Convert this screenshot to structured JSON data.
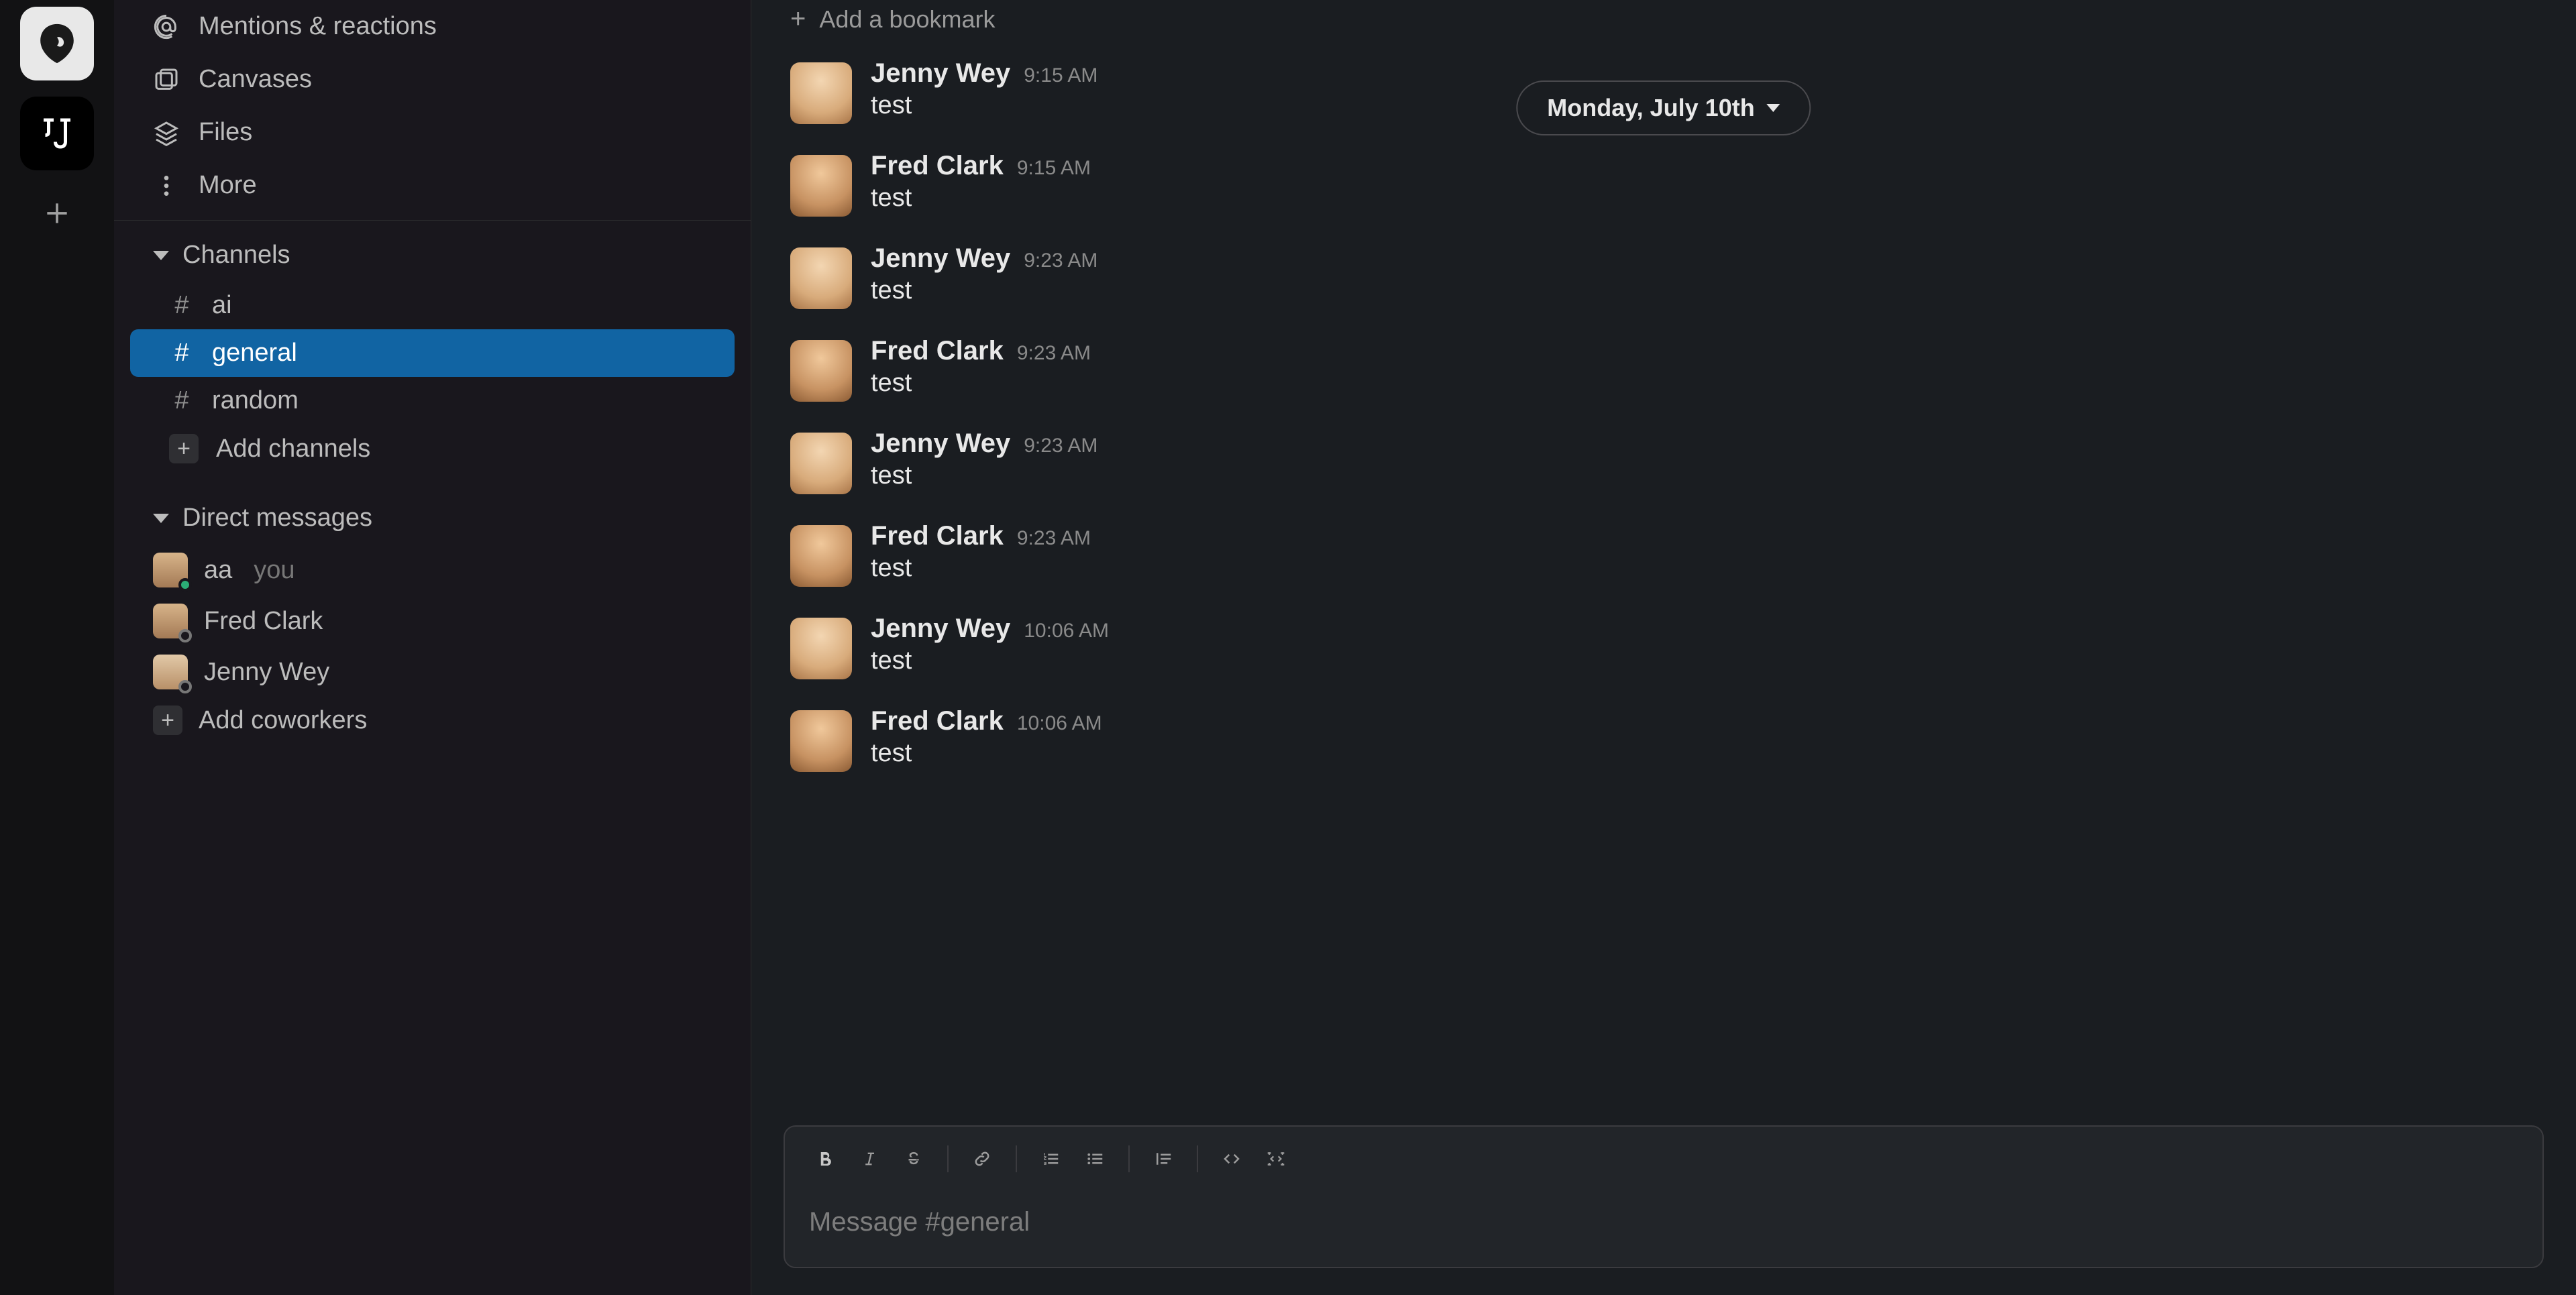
{
  "bookmark": {
    "label": "Add a bookmark"
  },
  "date_divider": "Monday, July 10th",
  "sidebar": {
    "browse": {
      "mentions": "Mentions & reactions",
      "canvases": "Canvases",
      "files": "Files",
      "more": "More"
    },
    "channels_header": "Channels",
    "channels": [
      {
        "name": "ai",
        "active": false
      },
      {
        "name": "general",
        "active": true
      },
      {
        "name": "random",
        "active": false
      }
    ],
    "add_channels": "Add channels",
    "dms_header": "Direct messages",
    "dms": [
      {
        "name": "aa",
        "you": "you",
        "avatar": "you",
        "presence": "online"
      },
      {
        "name": "Fred Clark",
        "avatar": "fred",
        "presence": "offline"
      },
      {
        "name": "Jenny Wey",
        "avatar": "jenny",
        "presence": "offline"
      }
    ],
    "add_coworkers": "Add coworkers"
  },
  "messages": [
    {
      "author": "Jenny Wey",
      "time": "9:15 AM",
      "text": "test",
      "avatar": "jenny"
    },
    {
      "author": "Fred Clark",
      "time": "9:15 AM",
      "text": "test",
      "avatar": "fred"
    },
    {
      "author": "Jenny Wey",
      "time": "9:23 AM",
      "text": "test",
      "avatar": "jenny"
    },
    {
      "author": "Fred Clark",
      "time": "9:23 AM",
      "text": "test",
      "avatar": "fred"
    },
    {
      "author": "Jenny Wey",
      "time": "9:23 AM",
      "text": "test",
      "avatar": "jenny"
    },
    {
      "author": "Fred Clark",
      "time": "9:23 AM",
      "text": "test",
      "avatar": "fred"
    },
    {
      "author": "Jenny Wey",
      "time": "10:06 AM",
      "text": "test",
      "avatar": "jenny"
    },
    {
      "author": "Fred Clark",
      "time": "10:06 AM",
      "text": "test",
      "avatar": "fred"
    }
  ],
  "composer": {
    "placeholder": "Message #general"
  }
}
